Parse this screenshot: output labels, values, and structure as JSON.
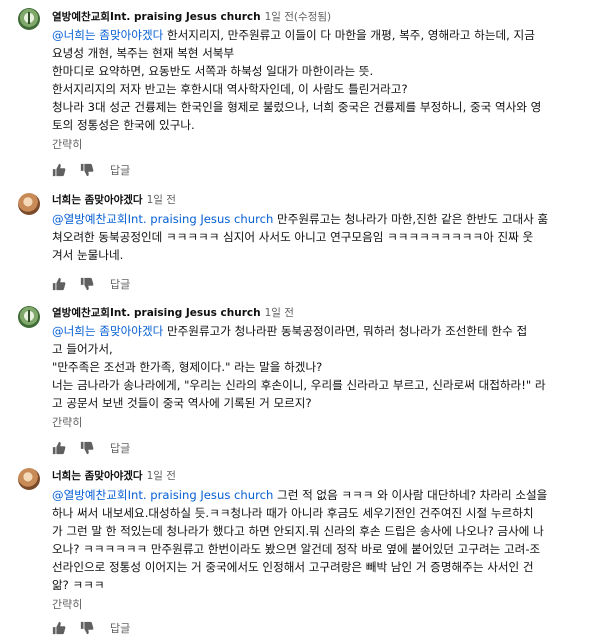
{
  "comments": [
    {
      "author": "열방예찬교회Int. praising Jesus church",
      "time": "1일 전(수정됨)",
      "mention": "@너희는 좀맞아야겠다",
      "first_text": " 한서지리지, 만주원류고 이들이 다 마한을 개평, 복주, 영해라고 하는데, 지금",
      "lines": [
        "요녕성 개현, 복주는 현재 복현 서북부",
        "한마디로 요약하면, 요동반도 서쪽과 하북성 일대가 마한이라는 뜻.",
        "한서지리지의 저자 반고는 후한시대 역사학자인데, 이 사람도 틀린거라고?",
        "청나라 3대 성군 건륭제는 한국인을 형제로 불렀으나,  너희 중국은 건륭제를 부정하니, 중국 역사와 영",
        "토의 정통성은 한국에 있구나."
      ],
      "more": "간략히",
      "reply": "답글"
    },
    {
      "author": "너희는 좀맞아야겠다",
      "time": "1일 전",
      "mention": "@열방예찬교회Int. praising Jesus church",
      "first_text": "  만주원류고는 청나라가 마한,진한 같은 한반도 고대사 훔",
      "lines": [
        "쳐오려한 동북공정인데 ㅋㅋㅋㅋㅋ 심지어 사서도 아니고 연구모음임 ㅋㅋㅋㅋㅋㅋㅋㅋㅋ아 진짜 웃",
        "겨서 눈물나네."
      ],
      "reply": "답글"
    },
    {
      "author": "열방예찬교회Int. praising Jesus church",
      "time": "1일 전",
      "mention": "@너희는 좀맞아야겠다",
      "first_text": "  만주원류고가 청나라판 동북공정이라면, 뭐하러 청나라가 조선한테 한수 접",
      "lines": [
        "고 들어가서,",
        "\"만주족은 조선과 한가족, 형제이다.\" 라는 말을 하겠나?",
        "너는 금나라가 송나라에게, \"우리는 신라의 후손이니, 우리를 신라라고 부르고, 신라로써 대접하라!\" 라",
        "고 공문서 보낸 것들이 중국 역사에 기록된 거 모르지?"
      ],
      "more": "간략히",
      "reply": "답글"
    },
    {
      "author": "너희는 좀맞아야겠다",
      "time": "1일 전",
      "mention": "@열방예찬교회Int. praising Jesus church",
      "first_text": "  그런 적 없음 ㅋㅋㅋ 와 이사람 대단하네? 차라리 소설을",
      "lines": [
        "하나 써서 내보세요.대성하실 듯.ㅋㅋ청나라 때가 아니라 후금도 세우기전인 건주여진 시절 누르하치",
        "가 그런 말 한 적있는데 청나라가 했다고 하면 안되지.뭐 신라의 후손 드립은 송사에 나오나? 금사에 나",
        "오나? ㅋㅋㅋㅋㅋㅋ 만주원류고 한번이라도 봤으면 알건데 정작 바로 옆에 붙어있던 고구려는 고려-조",
        "선라인으로 정통성 이어지는 거 중국에서도 인정해서 고구려랑은 빼박 남인 거 증명해주는 사서인 건",
        "앎? ㅋㅋㅋ"
      ],
      "more": "간략히",
      "reply": "답글"
    }
  ]
}
